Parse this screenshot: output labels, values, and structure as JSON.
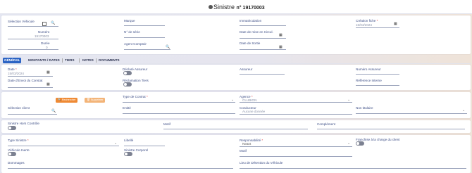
{
  "header": {
    "title": "Sinistre",
    "number": "n° 19170003"
  },
  "top": {
    "selection_vehicule": "Sélection Véhicule",
    "marque": "Marque",
    "immatriculation": "Immatriculation",
    "creation_fiche": "Création fiche",
    "creation_fiche_value": "15/03/2024",
    "numero": "Numéro",
    "numero_value": "19170003",
    "no_serie": "N° de série",
    "date_mise_circ": "Date de mise en Circul.",
    "duree": "Durée",
    "duree_value": "0",
    "agent_comptoir": "Agent Comptoir",
    "date_sortie": "Date de Sortie"
  },
  "tabs": [
    "GÉNÉRAL",
    "MONTANTS / DATES",
    "TIERS",
    "NOTES",
    "DOCUMENTS"
  ],
  "general": {
    "date": "Date",
    "date_value": "15/03/2024",
    "declare_assureur": "Déclaré Assureur",
    "assureur": "Assureur",
    "numero_assureur": "Numéro Assureur",
    "date_envoi_constat": "Date d'Envoi du Constat",
    "reclamation_tiers": "Réclamation Tiers",
    "reference_interne": "Référence Interne"
  },
  "client": {
    "type_contrat": "Type de Contrat",
    "agence": "Agence",
    "agence_value": "CLUBION",
    "selection_client": "Sélection client",
    "rechercher": "Rechercher",
    "supprimer": "Supprimer",
    "entite": "Entité",
    "conducteur": "Conducteur",
    "conducteur_value": "Aucune donnée",
    "non_titulaire": "Non titulaire"
  },
  "hors_controle": {
    "label": "Sinistre Hors Contrôle",
    "motif": "Motif",
    "complement": "Complément"
  },
  "sinistre": {
    "type_sinistre": "Type Sinistre",
    "libelle": "Libellé",
    "responsabilite": "Responsabilité",
    "responsabilite_value": "Neant",
    "franchise": "Franchise à la charge du client",
    "vehicule_inerte": "Véhicule Inerte",
    "sinistre_corporel": "Sinistre Corporel",
    "motif": "Motif",
    "dommages": "Dommages",
    "lieu_detention": "Lieu de Détention du Véhicule"
  },
  "icons": {
    "search": "search-icon",
    "calendar": "calendar-icon",
    "chevron": "chevron-down-icon"
  },
  "colors": {
    "accent": "#2b63c4",
    "search_button": "#ef8a34",
    "toggle": "#7c8191"
  }
}
